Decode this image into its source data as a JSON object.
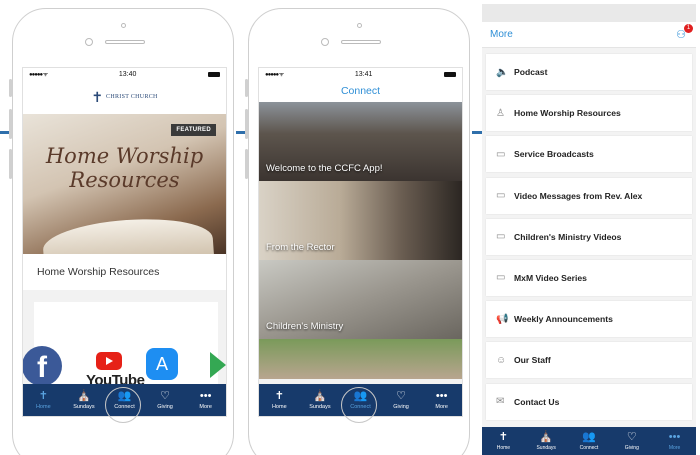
{
  "phone1": {
    "status": {
      "carrier": "●●●●● ᯤ",
      "time": "13:40"
    },
    "logo_text": "CHRIST CHURCH",
    "featured": {
      "badge": "FEATURED",
      "image_text": "Home Worship Resources",
      "caption": "Home Worship Resources"
    },
    "apps": {
      "facebook": "f",
      "youtube_text": "YouTube"
    },
    "tabs": [
      {
        "label": "Home",
        "icon": "✝",
        "icon_name": "cross-icon"
      },
      {
        "label": "Sundays",
        "icon": "⛪",
        "icon_name": "church-icon"
      },
      {
        "label": "Connect",
        "icon": "👥",
        "icon_name": "people-icon"
      },
      {
        "label": "Giving",
        "icon": "♡",
        "icon_name": "heart-icon"
      },
      {
        "label": "More",
        "icon": "•••",
        "icon_name": "more-icon"
      }
    ]
  },
  "phone2": {
    "status": {
      "carrier": "●●●●● ᯤ",
      "time": "13:41"
    },
    "title": "Connect",
    "tiles": [
      {
        "label": "Welcome to the CCFC App!"
      },
      {
        "label": "From the Rector"
      },
      {
        "label": "Children's Ministry"
      }
    ],
    "tabs": [
      {
        "label": "Home",
        "icon": "✝"
      },
      {
        "label": "Sundays",
        "icon": "⛪"
      },
      {
        "label": "Connect",
        "icon": "👥"
      },
      {
        "label": "Giving",
        "icon": "♡"
      },
      {
        "label": "More",
        "icon": "•••"
      }
    ]
  },
  "android": {
    "title": "More",
    "notification_count": "1",
    "items": [
      {
        "label": "Podcast",
        "icon": "🔈",
        "icon_name": "speaker-icon"
      },
      {
        "label": "Home Worship Resources",
        "icon": "♙",
        "icon_name": "person-pray-icon"
      },
      {
        "label": "Service Broadcasts",
        "icon": "▭",
        "icon_name": "video-icon"
      },
      {
        "label": "Video Messages from Rev. Alex",
        "icon": "▭",
        "icon_name": "video-icon"
      },
      {
        "label": "Children's Ministry Videos",
        "icon": "▭",
        "icon_name": "video-icon"
      },
      {
        "label": "MxM Video Series",
        "icon": "▭",
        "icon_name": "video-icon"
      },
      {
        "label": "Weekly Announcements",
        "icon": "📢",
        "icon_name": "megaphone-icon"
      },
      {
        "label": "Our Staff",
        "icon": "☺",
        "icon_name": "staff-icon"
      },
      {
        "label": "Contact Us",
        "icon": "✉",
        "icon_name": "mail-icon"
      }
    ],
    "tabs": [
      {
        "label": "Home",
        "icon": "✝"
      },
      {
        "label": "Sundays",
        "icon": "⛪"
      },
      {
        "label": "Connect",
        "icon": "👥"
      },
      {
        "label": "Giving",
        "icon": "♡"
      },
      {
        "label": "More",
        "icon": "•••"
      }
    ]
  },
  "colors": {
    "accent": "#2f8fd6",
    "tabbar": "#173a6b",
    "connector": "#2f6fab"
  }
}
